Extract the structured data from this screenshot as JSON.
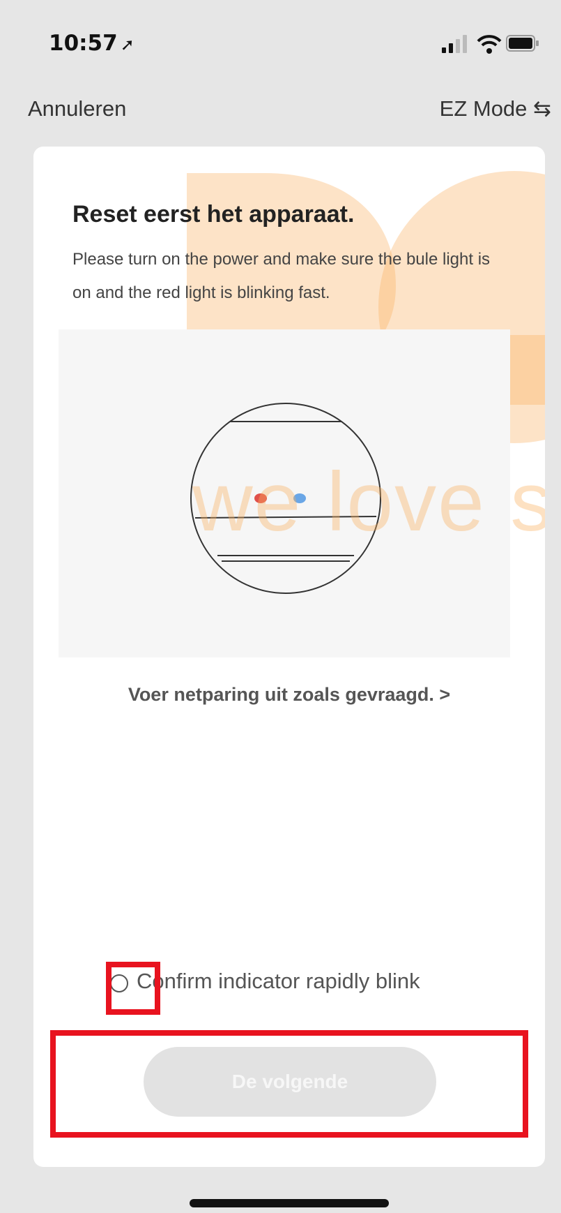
{
  "status_bar": {
    "time": "10:57",
    "location_icon": "location-arrow-icon"
  },
  "nav": {
    "cancel": "Annuleren",
    "mode": "EZ Mode ⇆"
  },
  "card": {
    "title": "Reset eerst het apparaat.",
    "description": "Please turn on the power and make sure the bule light is on and the red light is blinking fast.",
    "net_link": "Voer netparing uit zoals gevraagd. >",
    "confirm_label": "Confirm indicator rapidly blink",
    "next_button": "De volgende",
    "watermark": "we love sn"
  },
  "colors": {
    "highlight": "#e8131f",
    "watermark": "#f9af5f",
    "red_led": "#e0504a",
    "blue_led": "#6aa6e6"
  }
}
